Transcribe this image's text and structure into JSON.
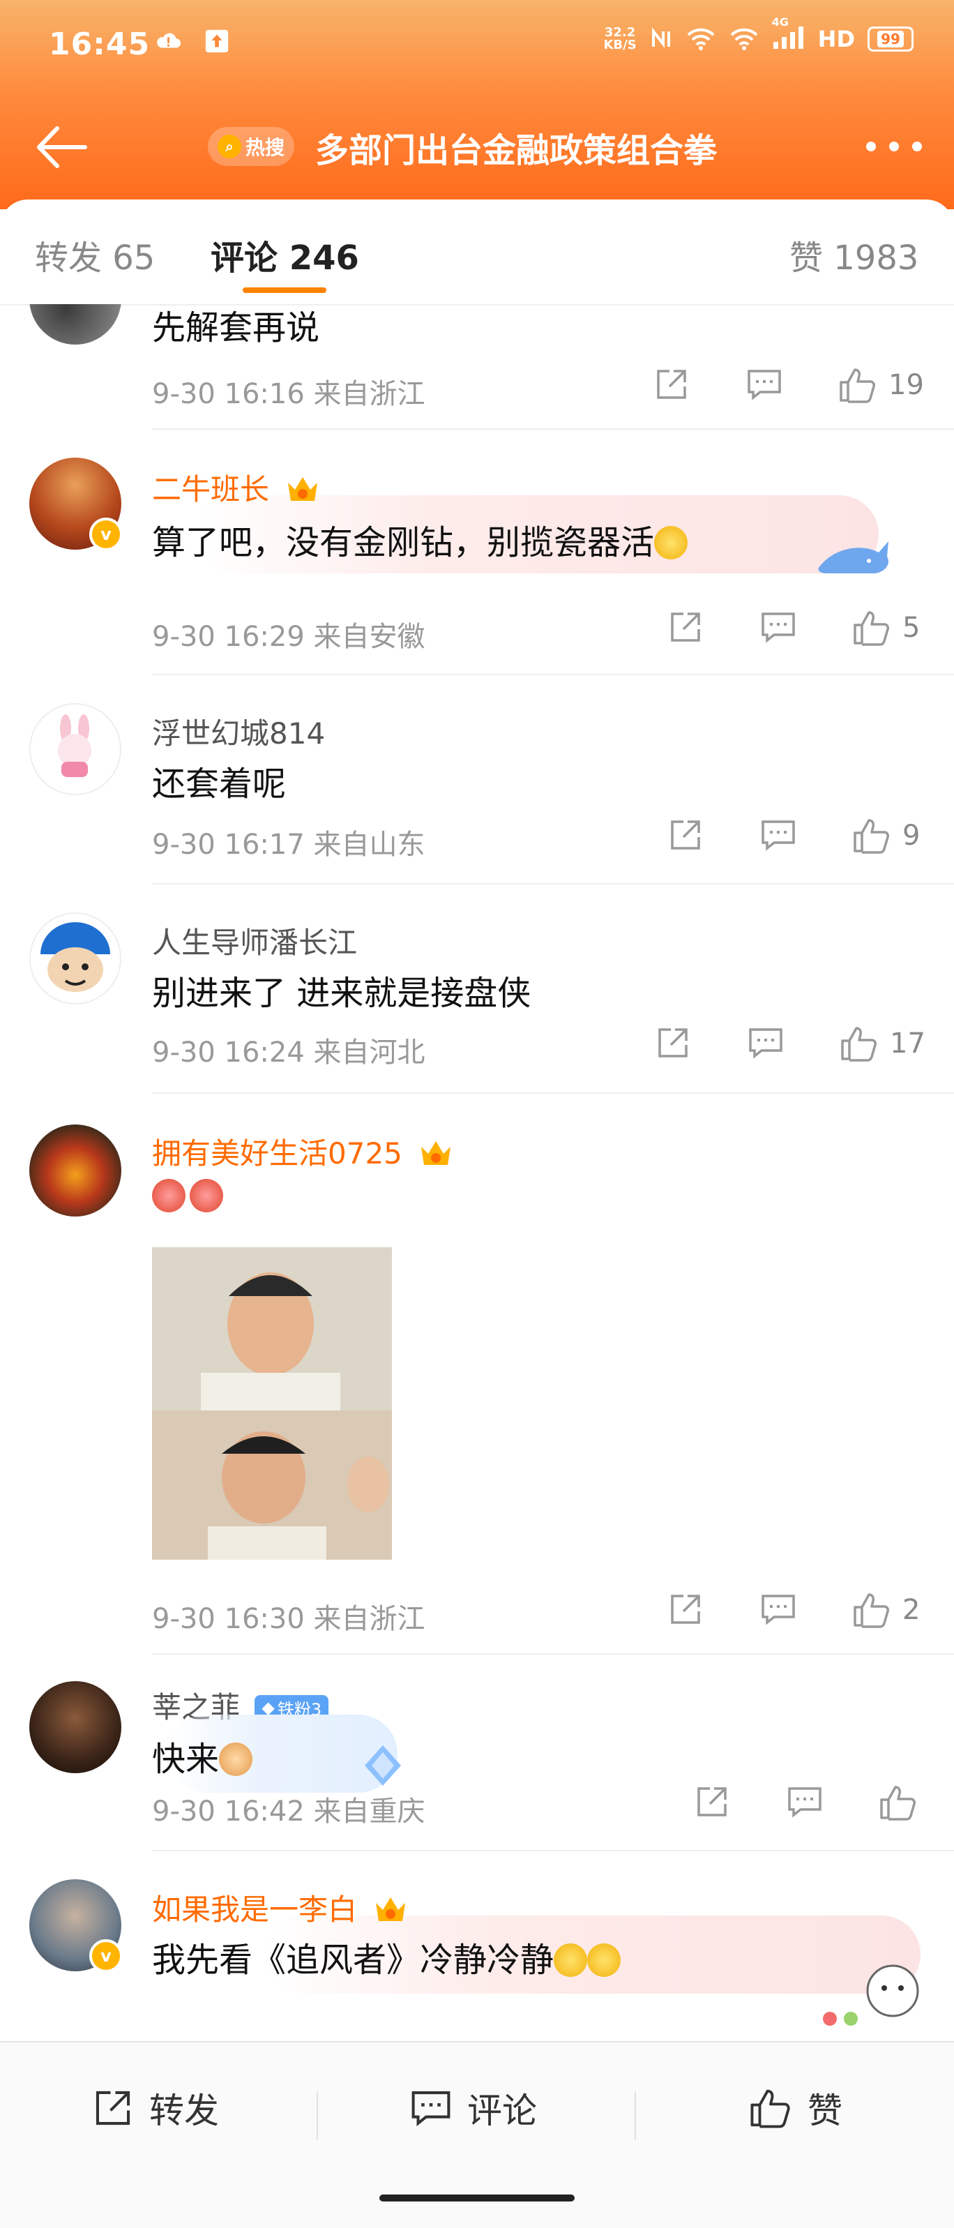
{
  "status_bar": {
    "time": "16:45",
    "net_speed_top": "32.2",
    "net_speed_unit": "KB/S",
    "network": "4G",
    "hd": "HD",
    "battery": "99"
  },
  "nav": {
    "hot_tag": "热搜",
    "title": "多部门出台金融政策组合拳"
  },
  "tabs": {
    "repost": "转发 65",
    "comments": "评论 246",
    "likes": "赞 1983"
  },
  "comments": [
    {
      "name": "",
      "text": "先解套再说",
      "date": "9-30 16:16",
      "location": "来自浙江",
      "likes": "19"
    },
    {
      "name": "二牛班长",
      "text": "算了吧，没有金刚钻，别揽瓷器活",
      "date": "9-30 16:29",
      "location": "来自安徽",
      "likes": "5"
    },
    {
      "name": "浮世幻城814",
      "text": "还套着呢",
      "date": "9-30 16:17",
      "location": "来自山东",
      "likes": "9"
    },
    {
      "name": "人生导师潘长江",
      "text": "别进来了 进来就是接盘侠",
      "date": "9-30 16:24",
      "location": "来自河北",
      "likes": "17"
    },
    {
      "name": "拥有美好生活0725",
      "text": "",
      "date": "9-30 16:30",
      "location": "来自浙江",
      "likes": "2"
    },
    {
      "name": "莘之菲",
      "badge": "铁粉3",
      "text": "快来",
      "date": "9-30 16:42",
      "location": "来自重庆",
      "likes": ""
    },
    {
      "name": "如果我是一李白",
      "text": "我先看《追风者》冷静冷静",
      "date": "",
      "location": "",
      "likes": ""
    }
  ],
  "bottom_bar": {
    "repost": "转发",
    "comment": "评论",
    "like": "赞"
  },
  "colors": {
    "accent": "#ff8200",
    "vip_name": "#ff6b00",
    "header": "#ff6a1a"
  }
}
